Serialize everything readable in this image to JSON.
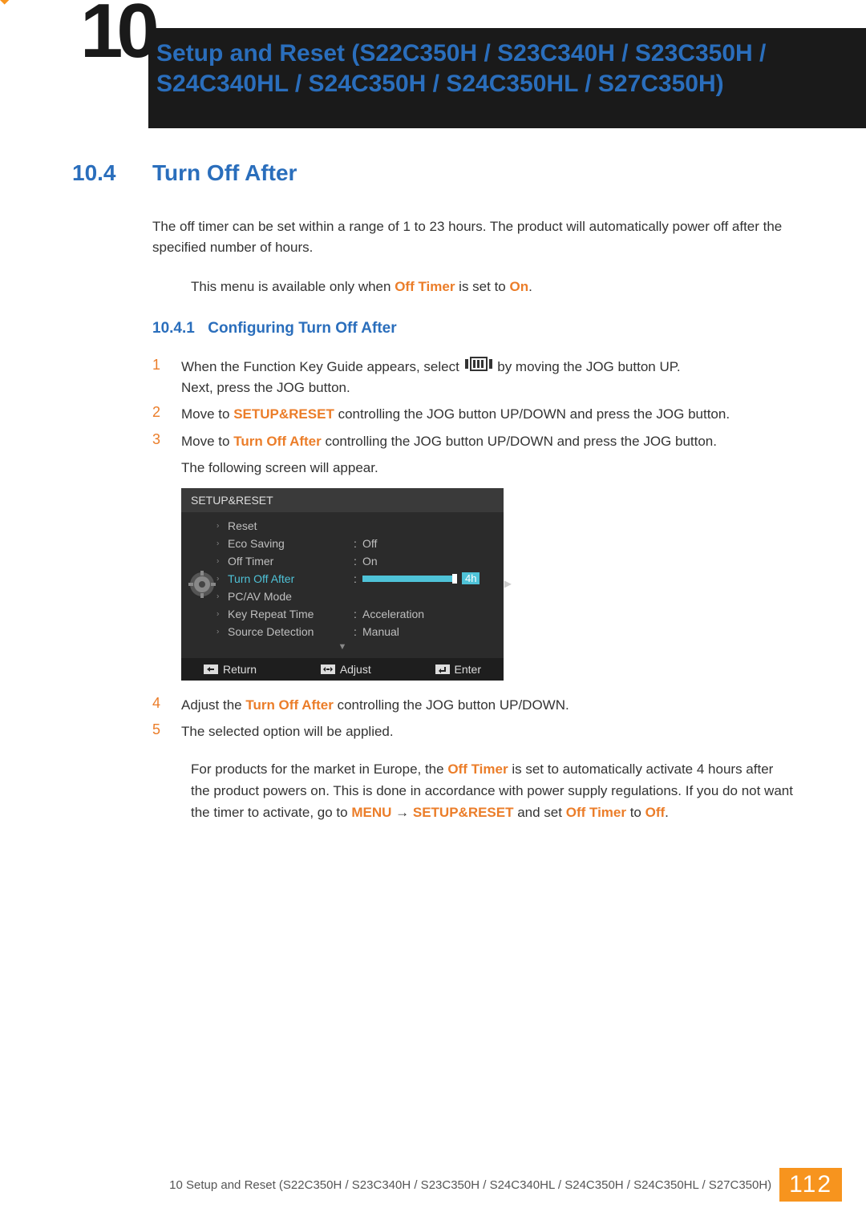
{
  "chapter": {
    "number": "10",
    "title": "Setup and Reset (S22C350H / S23C340H / S23C350H / S24C340HL / S24C350H / S24C350HL / S27C350H)"
  },
  "section": {
    "number": "10.4",
    "title": "Turn Off After"
  },
  "intro": "The off timer can be set within a range of 1 to 23 hours. The product will automatically power off after the specified number of hours.",
  "note": {
    "prefix": "This menu is available only when ",
    "bold1": "Off Timer",
    "mid": " is set to ",
    "bold2": "On",
    "suffix": "."
  },
  "subsection": {
    "number": "10.4.1",
    "title": "Configuring Turn Off After"
  },
  "steps": {
    "s1a": "When the Function Key Guide appears, select ",
    "s1b": " by moving the JOG button UP.",
    "s1c": "Next, press the JOG button.",
    "s2a": "Move to ",
    "s2b": "SETUP&RESET",
    "s2c": " controlling the JOG button UP/DOWN and press the JOG button.",
    "s3a": "Move to ",
    "s3b": "Turn Off After",
    "s3c": " controlling the JOG button UP/DOWN and press the JOG button.",
    "s3d": "The following screen will appear.",
    "s4a": "Adjust the ",
    "s4b": "Turn Off After",
    "s4c": " controlling the JOG button UP/DOWN.",
    "s5": "The selected option will be applied."
  },
  "osd": {
    "header": "SETUP&RESET",
    "rows": {
      "reset": "Reset",
      "eco": "Eco Saving",
      "eco_v": "Off",
      "off_timer": "Off Timer",
      "off_timer_v": "On",
      "turn_off": "Turn Off After",
      "turn_off_v": "4h",
      "pcav": "PC/AV Mode",
      "key_rep": "Key Repeat Time",
      "key_rep_v": "Acceleration",
      "src_det": "Source Detection",
      "src_det_v": "Manual"
    },
    "footer": {
      "return": "Return",
      "adjust": "Adjust",
      "enter": "Enter"
    }
  },
  "note2": {
    "p1": "For products for the market in Europe, the ",
    "b1": "Off Timer",
    "p2": " is set to automatically activate 4 hours after the product powers on. This is done in accordance with power supply regulations. If you do not want the timer to activate, go to ",
    "b2": "MENU",
    "p3": "  ",
    "arrow": "→",
    "p4": "  ",
    "b3": "SETUP&RESET",
    "p5": " and set ",
    "b4": "Off Timer",
    "p6": " to ",
    "b5": "Off",
    "p7": "."
  },
  "footer": {
    "text": "10 Setup and Reset (S22C350H / S23C340H / S23C350H / S24C340HL / S24C350H / S24C350HL / S27C350H)",
    "page": "112"
  },
  "chart_data": {
    "type": "table",
    "title": "SETUP&RESET OSD menu",
    "rows": [
      {
        "label": "Reset",
        "value": ""
      },
      {
        "label": "Eco Saving",
        "value": "Off"
      },
      {
        "label": "Off Timer",
        "value": "On"
      },
      {
        "label": "Turn Off After",
        "value": "4h",
        "active": true
      },
      {
        "label": "PC/AV Mode",
        "value": ""
      },
      {
        "label": "Key Repeat Time",
        "value": "Acceleration"
      },
      {
        "label": "Source Detection",
        "value": "Manual"
      }
    ],
    "footer_actions": [
      "Return",
      "Adjust",
      "Enter"
    ]
  }
}
